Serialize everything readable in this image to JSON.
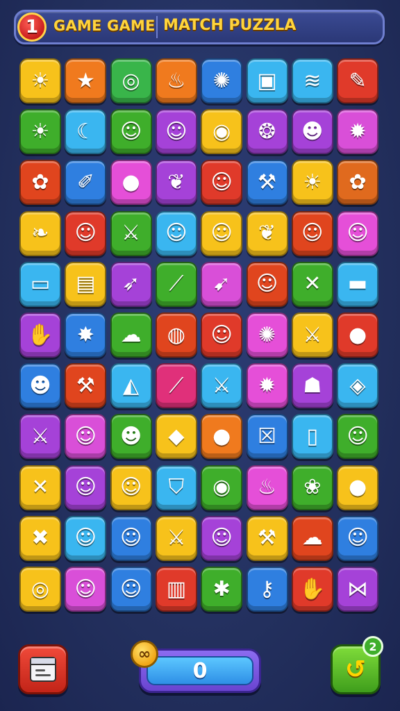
{
  "header": {
    "level": "1",
    "title_left": "GAME GAME",
    "title_right": "MATCH PUZZLA"
  },
  "board": {
    "rows": 11,
    "cols": 8,
    "tiles": [
      [
        {
          "color": "#f7c21b",
          "icon": "sun-icon",
          "glyph": "☀"
        },
        {
          "color": "#f07a1e",
          "icon": "star-icon",
          "glyph": "★"
        },
        {
          "color": "#39b54a",
          "icon": "spiral-icon",
          "glyph": "◎"
        },
        {
          "color": "#f07a1e",
          "icon": "flame-icon",
          "glyph": "♨"
        },
        {
          "color": "#2f7fe0",
          "icon": "sun-face-icon",
          "glyph": "✺"
        },
        {
          "color": "#3ab6f0",
          "icon": "jar-icon",
          "glyph": "▣"
        },
        {
          "color": "#3ab6f0",
          "icon": "stack-icon",
          "glyph": "≋"
        },
        {
          "color": "#e03a2a",
          "icon": "pencil-icon",
          "glyph": "✎"
        }
      ],
      [
        {
          "color": "#3fae2b",
          "icon": "sun-icon",
          "glyph": "☀"
        },
        {
          "color": "#3ab6f0",
          "icon": "moon-face-icon",
          "glyph": "☾"
        },
        {
          "color": "#3fae2b",
          "icon": "person-icon",
          "glyph": "☺"
        },
        {
          "color": "#a542d8",
          "icon": "person-icon",
          "glyph": "☺"
        },
        {
          "color": "#f7c21b",
          "icon": "swirl-icon",
          "glyph": "◉"
        },
        {
          "color": "#a542d8",
          "icon": "cookie-icon",
          "glyph": "❂"
        },
        {
          "color": "#a542d8",
          "icon": "cat-icon",
          "glyph": "☻"
        },
        {
          "color": "#d94fd8",
          "icon": "gear-icon",
          "glyph": "✹"
        }
      ],
      [
        {
          "color": "#e0451e",
          "icon": "flower-icon",
          "glyph": "✿"
        },
        {
          "color": "#2f7fe0",
          "icon": "brush-icon",
          "glyph": "✐"
        },
        {
          "color": "#e54fd8",
          "icon": "orange-icon",
          "glyph": "●"
        },
        {
          "color": "#a542d8",
          "icon": "leaf-icon",
          "glyph": "❦"
        },
        {
          "color": "#e03a2a",
          "icon": "person-icon",
          "glyph": "☺"
        },
        {
          "color": "#2f7fe0",
          "icon": "hammer-icon",
          "glyph": "⚒"
        },
        {
          "color": "#f7c21b",
          "icon": "sun-icon",
          "glyph": "☀"
        },
        {
          "color": "#e06a1e",
          "icon": "flower-icon",
          "glyph": "✿"
        }
      ],
      [
        {
          "color": "#f7c21b",
          "icon": "leaf-icon",
          "glyph": "❧"
        },
        {
          "color": "#e03a2a",
          "icon": "person-icon",
          "glyph": "☺"
        },
        {
          "color": "#3fae2b",
          "icon": "crossed-swords-icon",
          "glyph": "⚔"
        },
        {
          "color": "#3ab6f0",
          "icon": "person-icon",
          "glyph": "☺"
        },
        {
          "color": "#f7c21b",
          "icon": "person-icon",
          "glyph": "☺"
        },
        {
          "color": "#f7c21b",
          "icon": "leaf-icon",
          "glyph": "❦"
        },
        {
          "color": "#e0451e",
          "icon": "person-icon",
          "glyph": "☺"
        },
        {
          "color": "#e54fd8",
          "icon": "person-icon",
          "glyph": "☺"
        }
      ],
      [
        {
          "color": "#3ab6f0",
          "icon": "card-icon",
          "glyph": "▭"
        },
        {
          "color": "#f7c21b",
          "icon": "calendar-icon",
          "glyph": "▤"
        },
        {
          "color": "#a542d8",
          "icon": "bow-icon",
          "glyph": "➶"
        },
        {
          "color": "#3fae2b",
          "icon": "wand-icon",
          "glyph": "⟋"
        },
        {
          "color": "#d94fd8",
          "icon": "arrow-icon",
          "glyph": "➹"
        },
        {
          "color": "#e0451e",
          "icon": "person-icon",
          "glyph": "☺"
        },
        {
          "color": "#3fae2b",
          "icon": "crossed-swords-icon",
          "glyph": "✕"
        },
        {
          "color": "#3ab6f0",
          "icon": "sign-icon",
          "glyph": "▬"
        }
      ],
      [
        {
          "color": "#a542d8",
          "icon": "drumstick-icon",
          "glyph": "✋"
        },
        {
          "color": "#2f7fe0",
          "icon": "star-burst-icon",
          "glyph": "✸"
        },
        {
          "color": "#3fae2b",
          "icon": "cloud-icon",
          "glyph": "☁"
        },
        {
          "color": "#e0451e",
          "icon": "spiral-icon",
          "glyph": "◍"
        },
        {
          "color": "#e03a2a",
          "icon": "person-icon",
          "glyph": "☺"
        },
        {
          "color": "#e54fd8",
          "icon": "gear-icon",
          "glyph": "✺"
        },
        {
          "color": "#f7c21b",
          "icon": "crossed-swords-icon",
          "glyph": "⚔"
        },
        {
          "color": "#e03a2a",
          "icon": "bomb-icon",
          "glyph": "●"
        }
      ],
      [
        {
          "color": "#2f7fe0",
          "icon": "blob-face-icon",
          "glyph": "☻"
        },
        {
          "color": "#e0451e",
          "icon": "crossed-tools-icon",
          "glyph": "⚒"
        },
        {
          "color": "#3ab6f0",
          "icon": "guitar-pick-icon",
          "glyph": "◭"
        },
        {
          "color": "#e0307a",
          "icon": "wand-icon",
          "glyph": "⟋"
        },
        {
          "color": "#3ab6f0",
          "icon": "crossed-tools-icon",
          "glyph": "⚔"
        },
        {
          "color": "#e54fd8",
          "icon": "gear-icon",
          "glyph": "✹"
        },
        {
          "color": "#a542d8",
          "icon": "ghost-icon",
          "glyph": "☗"
        },
        {
          "color": "#3ab6f0",
          "icon": "leaf-icon",
          "glyph": "◈"
        }
      ],
      [
        {
          "color": "#a542d8",
          "icon": "crossed-swords-icon",
          "glyph": "⚔"
        },
        {
          "color": "#d94fd8",
          "icon": "person-icon",
          "glyph": "☺"
        },
        {
          "color": "#3fae2b",
          "icon": "person-icon",
          "glyph": "☻"
        },
        {
          "color": "#f7c21b",
          "icon": "diamond-icon",
          "glyph": "◆"
        },
        {
          "color": "#f07a1e",
          "icon": "flame-icon",
          "glyph": "●"
        },
        {
          "color": "#2f7fe0",
          "icon": "crate-icon",
          "glyph": "☒"
        },
        {
          "color": "#3ab6f0",
          "icon": "door-icon",
          "glyph": "▯"
        },
        {
          "color": "#3fae2b",
          "icon": "person-icon",
          "glyph": "☺"
        }
      ],
      [
        {
          "color": "#f7c21b",
          "icon": "crossed-swords-icon",
          "glyph": "✕"
        },
        {
          "color": "#a542d8",
          "icon": "person-icon",
          "glyph": "☺"
        },
        {
          "color": "#f7c21b",
          "icon": "person-icon",
          "glyph": "☺"
        },
        {
          "color": "#3ab6f0",
          "icon": "shield-icon",
          "glyph": "⛉"
        },
        {
          "color": "#3fae2b",
          "icon": "swirl-icon",
          "glyph": "◉"
        },
        {
          "color": "#e54fd8",
          "icon": "flame-icon",
          "glyph": "♨"
        },
        {
          "color": "#3fae2b",
          "icon": "plant-icon",
          "glyph": "❀"
        },
        {
          "color": "#f7c21b",
          "icon": "apple-icon",
          "glyph": "●"
        }
      ],
      [
        {
          "color": "#f7c21b",
          "icon": "crossed-tools-icon",
          "glyph": "✖"
        },
        {
          "color": "#3ab6f0",
          "icon": "person-icon",
          "glyph": "☺"
        },
        {
          "color": "#2f7fe0",
          "icon": "person-icon",
          "glyph": "☺"
        },
        {
          "color": "#f7c21b",
          "icon": "crossed-swords-icon",
          "glyph": "⚔"
        },
        {
          "color": "#a542d8",
          "icon": "person-icon",
          "glyph": "☺"
        },
        {
          "color": "#f7c21b",
          "icon": "crossed-tools-icon",
          "glyph": "⚒"
        },
        {
          "color": "#e0451e",
          "icon": "cloud-icon",
          "glyph": "☁"
        },
        {
          "color": "#2f7fe0",
          "icon": "person-icon",
          "glyph": "☺"
        }
      ],
      [
        {
          "color": "#f7c21b",
          "icon": "swirl-icon",
          "glyph": "◎"
        },
        {
          "color": "#d94fd8",
          "icon": "person-icon",
          "glyph": "☺"
        },
        {
          "color": "#2f7fe0",
          "icon": "person-icon",
          "glyph": "☺"
        },
        {
          "color": "#e03a2a",
          "icon": "book-icon",
          "glyph": "▥"
        },
        {
          "color": "#3fae2b",
          "icon": "bug-icon",
          "glyph": "✱"
        },
        {
          "color": "#2f7fe0",
          "icon": "key-icon",
          "glyph": "⚷"
        },
        {
          "color": "#e03a2a",
          "icon": "hand-icon",
          "glyph": "✋"
        },
        {
          "color": "#a542d8",
          "icon": "bowtie-icon",
          "glyph": "⋈"
        }
      ]
    ]
  },
  "footer": {
    "score": "0",
    "infinity": "∞",
    "hint_count": "2"
  }
}
